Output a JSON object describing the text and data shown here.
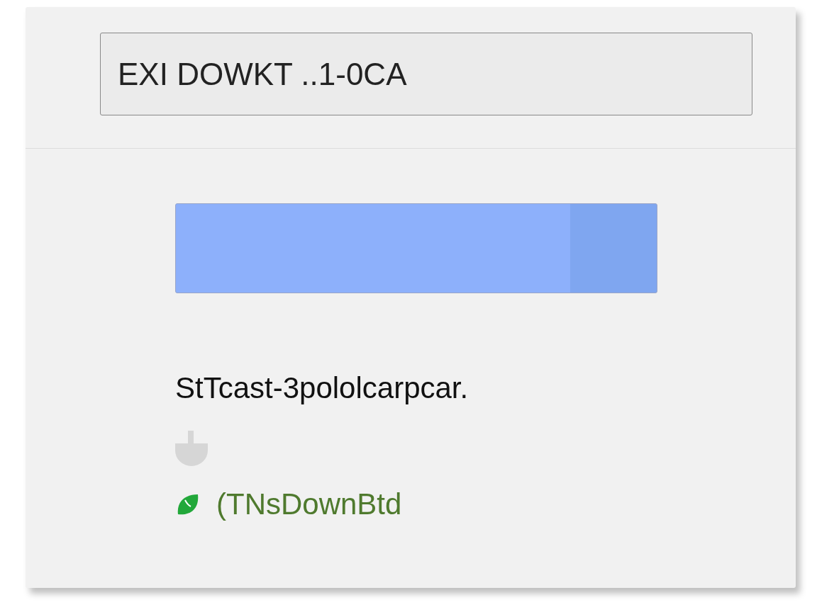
{
  "address_field": {
    "value": "EXI DOWKT ..1-0CA"
  },
  "progress": {
    "level": 0.82
  },
  "status_text": "StTcast-3pololcarpcar.",
  "download_status": {
    "text": "(TNsDownBtd"
  }
}
